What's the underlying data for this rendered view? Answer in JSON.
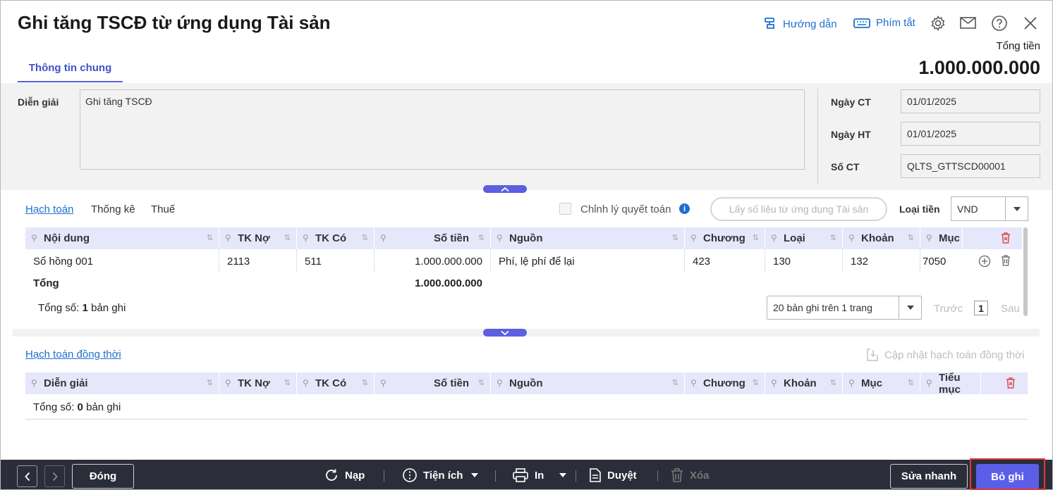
{
  "header": {
    "title": "Ghi tăng TSCĐ từ ứng dụng Tài sản",
    "guide_label": "Hướng dẫn",
    "shortcut_label": "Phím tắt",
    "total_label": "Tổng tiền",
    "total_value": "1.000.000.000"
  },
  "tabs": {
    "general": "Thông tin chung"
  },
  "info": {
    "description_label": "Diễn giải",
    "description_value": "Ghi tăng TSCĐ",
    "doc_date_label": "Ngày CT",
    "doc_date_value": "01/01/2025",
    "post_date_label": "Ngày HT",
    "post_date_value": "01/01/2025",
    "doc_no_label": "Số CT",
    "doc_no_value": "QLTS_GTTSCD00001"
  },
  "subtabs": [
    "Hạch toán",
    "Thống kê",
    "Thuế"
  ],
  "options": {
    "adjust_label": "Chỉnh lý quyết toán",
    "fetch_button": "Lấy số liệu từ ứng dụng Tài sản",
    "currency_label": "Loại tiền",
    "currency_value": "VND"
  },
  "accounting_table": {
    "columns": [
      "Nội dung",
      "TK Nợ",
      "TK Có",
      "Số tiền",
      "Nguồn",
      "Chương",
      "Loại",
      "Khoản",
      "Mục"
    ],
    "rows": [
      {
        "noi_dung": "Sổ hồng 001",
        "tk_no": "2113",
        "tk_co": "511",
        "so_tien": "1.000.000.000",
        "nguon": "Phí, lệ phí để lại",
        "chuong": "423",
        "loai": "130",
        "khoan": "132",
        "muc": "7050"
      }
    ],
    "total_label": "Tổng",
    "total_value": "1.000.000.000",
    "count_prefix": "Tổng số:",
    "count_value": "1",
    "count_suffix": "bản ghi",
    "page_size_option": "20 bản ghi trên 1 trang",
    "prev_label": "Trước",
    "page_number": "1",
    "next_label": "Sau"
  },
  "concurrent": {
    "title": "Hạch toán đồng thời",
    "update_label": "Cập nhật hạch toán đồng thời",
    "columns": [
      "Diễn giải",
      "TK Nợ",
      "TK Có",
      "Số tiền",
      "Nguồn",
      "Chương",
      "Khoản",
      "Mục",
      "Tiểu mục"
    ],
    "count_prefix": "Tổng số:",
    "count_value": "0",
    "count_suffix": "bản ghi"
  },
  "footer": {
    "close": "Đóng",
    "reload": "Nạp",
    "utilities": "Tiện ích",
    "print": "In",
    "approve": "Duyệt",
    "delete": "Xóa",
    "quick_edit": "Sửa nhanh",
    "unpost": "Bỏ ghi"
  },
  "colors": {
    "accent": "#5b5fe8",
    "link": "#1f6fd0",
    "footer_bg": "#2b2d3a",
    "highlight": "#e53935"
  }
}
